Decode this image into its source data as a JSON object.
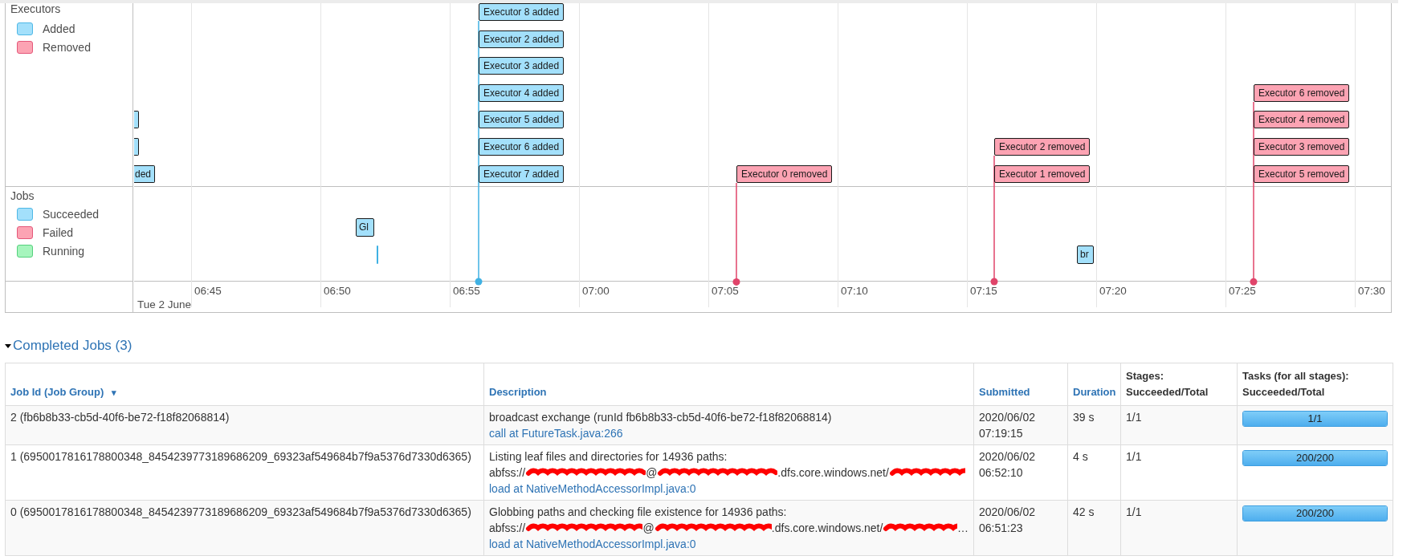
{
  "timeline": {
    "groups": [
      {
        "title": "Executors",
        "legend": [
          {
            "label": "Added",
            "kind": "added"
          },
          {
            "label": "Removed",
            "kind": "removed"
          }
        ]
      },
      {
        "title": "Jobs",
        "legend": [
          {
            "label": "Succeeded",
            "kind": "succeeded"
          },
          {
            "label": "Failed",
            "kind": "failed"
          },
          {
            "label": "Running",
            "kind": "running"
          }
        ]
      }
    ],
    "executor_clusters": [
      {
        "events": [
          {
            "kind": "added"
          },
          {
            "kind": "added"
          },
          {
            "label": "ded",
            "kind": "added"
          }
        ]
      },
      {
        "events": [
          {
            "label": "Executor 8 added",
            "kind": "added"
          },
          {
            "label": "Executor 2 added",
            "kind": "added"
          },
          {
            "label": "Executor 3 added",
            "kind": "added"
          },
          {
            "label": "Executor 4 added",
            "kind": "added"
          },
          {
            "label": "Executor 5 added",
            "kind": "added"
          },
          {
            "label": "Executor 6 added",
            "kind": "added"
          },
          {
            "label": "Executor 7 added",
            "kind": "added"
          }
        ]
      },
      {
        "events": [
          {
            "label": "Executor 0 removed",
            "kind": "removed"
          }
        ]
      },
      {
        "events": [
          {
            "label": "Executor 2 removed",
            "kind": "removed"
          },
          {
            "label": "Executor 1 removed",
            "kind": "removed"
          }
        ]
      },
      {
        "events": [
          {
            "label": "Executor 6 removed",
            "kind": "removed"
          },
          {
            "label": "Executor 4 removed",
            "kind": "removed"
          },
          {
            "label": "Executor 3 removed",
            "kind": "removed"
          },
          {
            "label": "Executor 5 removed",
            "kind": "removed"
          }
        ]
      }
    ],
    "job_events": [
      {
        "label": "Gl",
        "kind": "succeeded"
      },
      {
        "kind": "succeeded"
      },
      {
        "label": "br",
        "kind": "succeeded"
      }
    ],
    "axis_ticks": [
      "06:45",
      "06:50",
      "06:55",
      "07:00",
      "07:05",
      "07:10",
      "07:15",
      "07:20",
      "07:25",
      "07:30"
    ],
    "date_label": "Tue 2 June"
  },
  "completed_jobs": {
    "title": "Completed Jobs (3)",
    "expanded": true,
    "columns": [
      {
        "label": "Job Id (Job Group)",
        "sortable": true,
        "sort_indicator": "▾"
      },
      {
        "label": "Description",
        "sortable": true
      },
      {
        "label": "Submitted",
        "sortable": true
      },
      {
        "label": "Duration",
        "sortable": true
      },
      {
        "label": "Stages: Succeeded/Total",
        "sortable": false
      },
      {
        "label": "Tasks (for all stages): Succeeded/Total",
        "sortable": false
      }
    ],
    "rows": [
      {
        "job": "2 (fb6b8b33-cb5d-40f6-be72-f18f82068814)",
        "summary": "broadcast exchange (runId fb6b8b33-cb5d-40f6-be72-f18f82068814)",
        "callsite": "call at FutureTask.java:266",
        "submitted": "2020/06/02 07:19:15",
        "duration": "39 s",
        "stages": "1/1",
        "tasks": {
          "label": "1/1",
          "level": 1
        }
      },
      {
        "job": "1 (6950017816178800348_8454239773189686209_69323af549684b7f9a5376d7330d6365)",
        "summary": "Listing leaf files and directories for 14936 paths:",
        "path": [
          {
            "kind": "text",
            "text": "abfss://"
          },
          {
            "kind": "redacted"
          },
          {
            "kind": "text",
            "text": "@"
          },
          {
            "kind": "redacted"
          },
          {
            "kind": "text",
            "text": ".dfs.core.windows.net/"
          },
          {
            "kind": "redacted"
          }
        ],
        "callsite": "load at NativeMethodAccessorImpl.java:0",
        "submitted": "2020/06/02 06:52:10",
        "duration": "4 s",
        "stages": "1/1",
        "tasks": {
          "label": "200/200",
          "level": 1
        }
      },
      {
        "job": "0 (6950017816178800348_8454239773189686209_69323af549684b7f9a5376d7330d6365)",
        "summary": "Globbing paths and checking file existence for 14936 paths:",
        "path": [
          {
            "kind": "text",
            "text": "abfss://"
          },
          {
            "kind": "redacted"
          },
          {
            "kind": "text",
            "text": "@"
          },
          {
            "kind": "redacted"
          },
          {
            "kind": "text",
            "text": ".dfs.core.windows.net/"
          },
          {
            "kind": "redacted"
          },
          {
            "kind": "text",
            "text": "…"
          }
        ],
        "callsite": "load at NativeMethodAccessorImpl.java:0",
        "submitted": "2020/06/02 06:51:23",
        "duration": "42 s",
        "stages": "1/1",
        "tasks": {
          "label": "200/200",
          "level": 1
        }
      }
    ]
  }
}
